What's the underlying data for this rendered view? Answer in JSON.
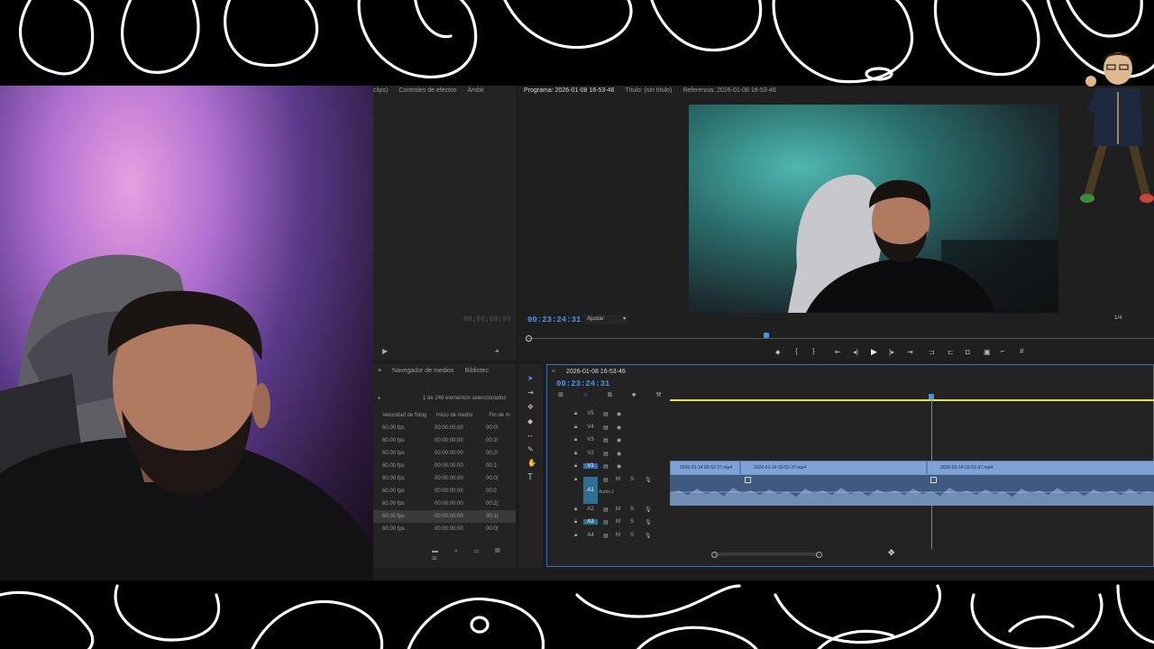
{
  "source_panel": {
    "tabs": [
      "clips)",
      "Controles de efectos",
      "Ámbit"
    ],
    "timecode": "00;00;00;00"
  },
  "program_monitor": {
    "tabs": [
      "Programa: 2026-01-08 16-53-46",
      "Título: (sin título)",
      "Referencia: 2026-01-08 16-53-46"
    ],
    "timecode": "00:23:24:31",
    "fit": "Ajustar",
    "resolution": "1/4"
  },
  "project_panel": {
    "tabs": [
      "Navegador de medios",
      "Bibliotec"
    ],
    "status": "1 de 249 elementos seleccionados",
    "columns": [
      "Velocidad de fotog",
      "Inicio de medio",
      "Fin de m"
    ],
    "rows": [
      [
        "60.00 fps",
        "00:00:00:00",
        "00:0!"
      ],
      [
        "60.00 fps",
        "00:00:00:00",
        "00:2!"
      ],
      [
        "60.00 fps",
        "00:00:00:00",
        "00:2!"
      ],
      [
        "60.00 fps",
        "00:00:00:00",
        "00:1:"
      ],
      [
        "60.00 fps",
        "00:00:00:00",
        "00:0("
      ],
      [
        "60.00 fps",
        "00:00:00:00",
        "00:0"
      ],
      [
        "60.00 fps",
        "00:00:00:00",
        "00:2("
      ],
      [
        "60.00 fps",
        "00:00:00:00",
        "00:1("
      ],
      [
        "60.00 fps",
        "00:00:00:00",
        "00:0("
      ]
    ]
  },
  "timeline": {
    "sequence_name": "2026-01-08 16-53-46",
    "timecode": "00:23:24:31",
    "video_tracks": [
      "V5",
      "V4",
      "V3",
      "V2",
      "V1"
    ],
    "audio_tracks": [
      "A1",
      "A2",
      "A3",
      "A4"
    ],
    "audio1_name": "Audio 1",
    "clips": [
      "2026-01-14 03-52-37.mp4",
      "2026-01-14 03-52-37.mp4",
      "2026-01-14 03-52-37.mp4"
    ],
    "mute_label": "M",
    "solo_label": "S"
  },
  "colors": {
    "accent": "#4a90e2",
    "clip": "#7ea1d6",
    "audio": "#3f5a80",
    "work_area": "#e8e83c"
  }
}
